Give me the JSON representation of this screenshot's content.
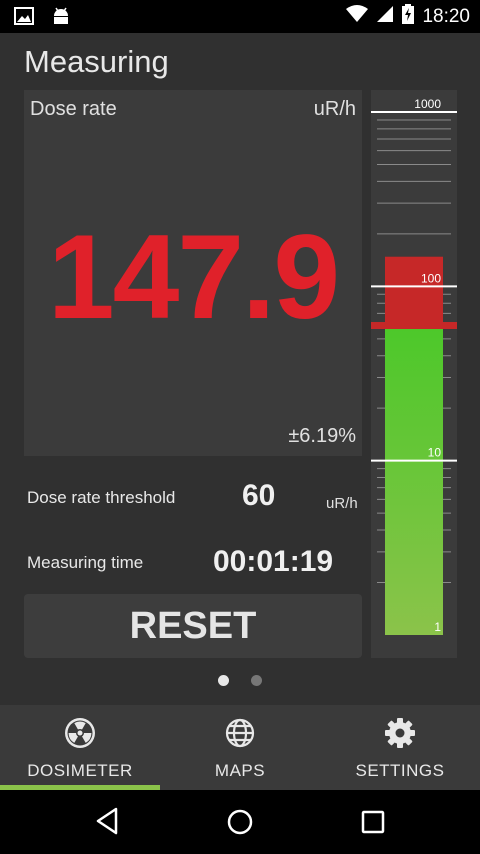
{
  "status_bar": {
    "time": "18:20",
    "icons": [
      "image-icon",
      "android-icon",
      "wifi-icon",
      "signal-icon",
      "battery-charging-icon"
    ]
  },
  "screen": {
    "title": "Measuring"
  },
  "dose": {
    "label": "Dose rate",
    "unit": "uR/h",
    "value": "147.9",
    "error": "±6.19%",
    "color": "#e0212a"
  },
  "threshold": {
    "label": "Dose rate threshold",
    "value": "60",
    "unit": "uR/h"
  },
  "measuring_time": {
    "label": "Measuring time",
    "value": "00:01:19"
  },
  "reset_label": "RESET",
  "gauge": {
    "scale": "log",
    "min": 1,
    "max": 1000,
    "tick_labels": [
      "1000",
      "100",
      "10",
      "1"
    ],
    "level": 147.9,
    "threshold": 60,
    "colors": {
      "danger": "#c62828",
      "safe_top": "#4cc82a",
      "safe_bottom": "#8bc34a",
      "marker": "#c62828"
    }
  },
  "pager": {
    "pages": 2,
    "active": 0
  },
  "bottom_nav": {
    "items": [
      {
        "label": "DOSIMETER",
        "icon": "radiation-icon",
        "active": true
      },
      {
        "label": "MAPS",
        "icon": "globe-icon",
        "active": false
      },
      {
        "label": "SETTINGS",
        "icon": "gear-icon",
        "active": false
      }
    ],
    "accent": "#8bc34a"
  },
  "system_nav": [
    "back-icon",
    "home-icon",
    "recents-icon"
  ]
}
